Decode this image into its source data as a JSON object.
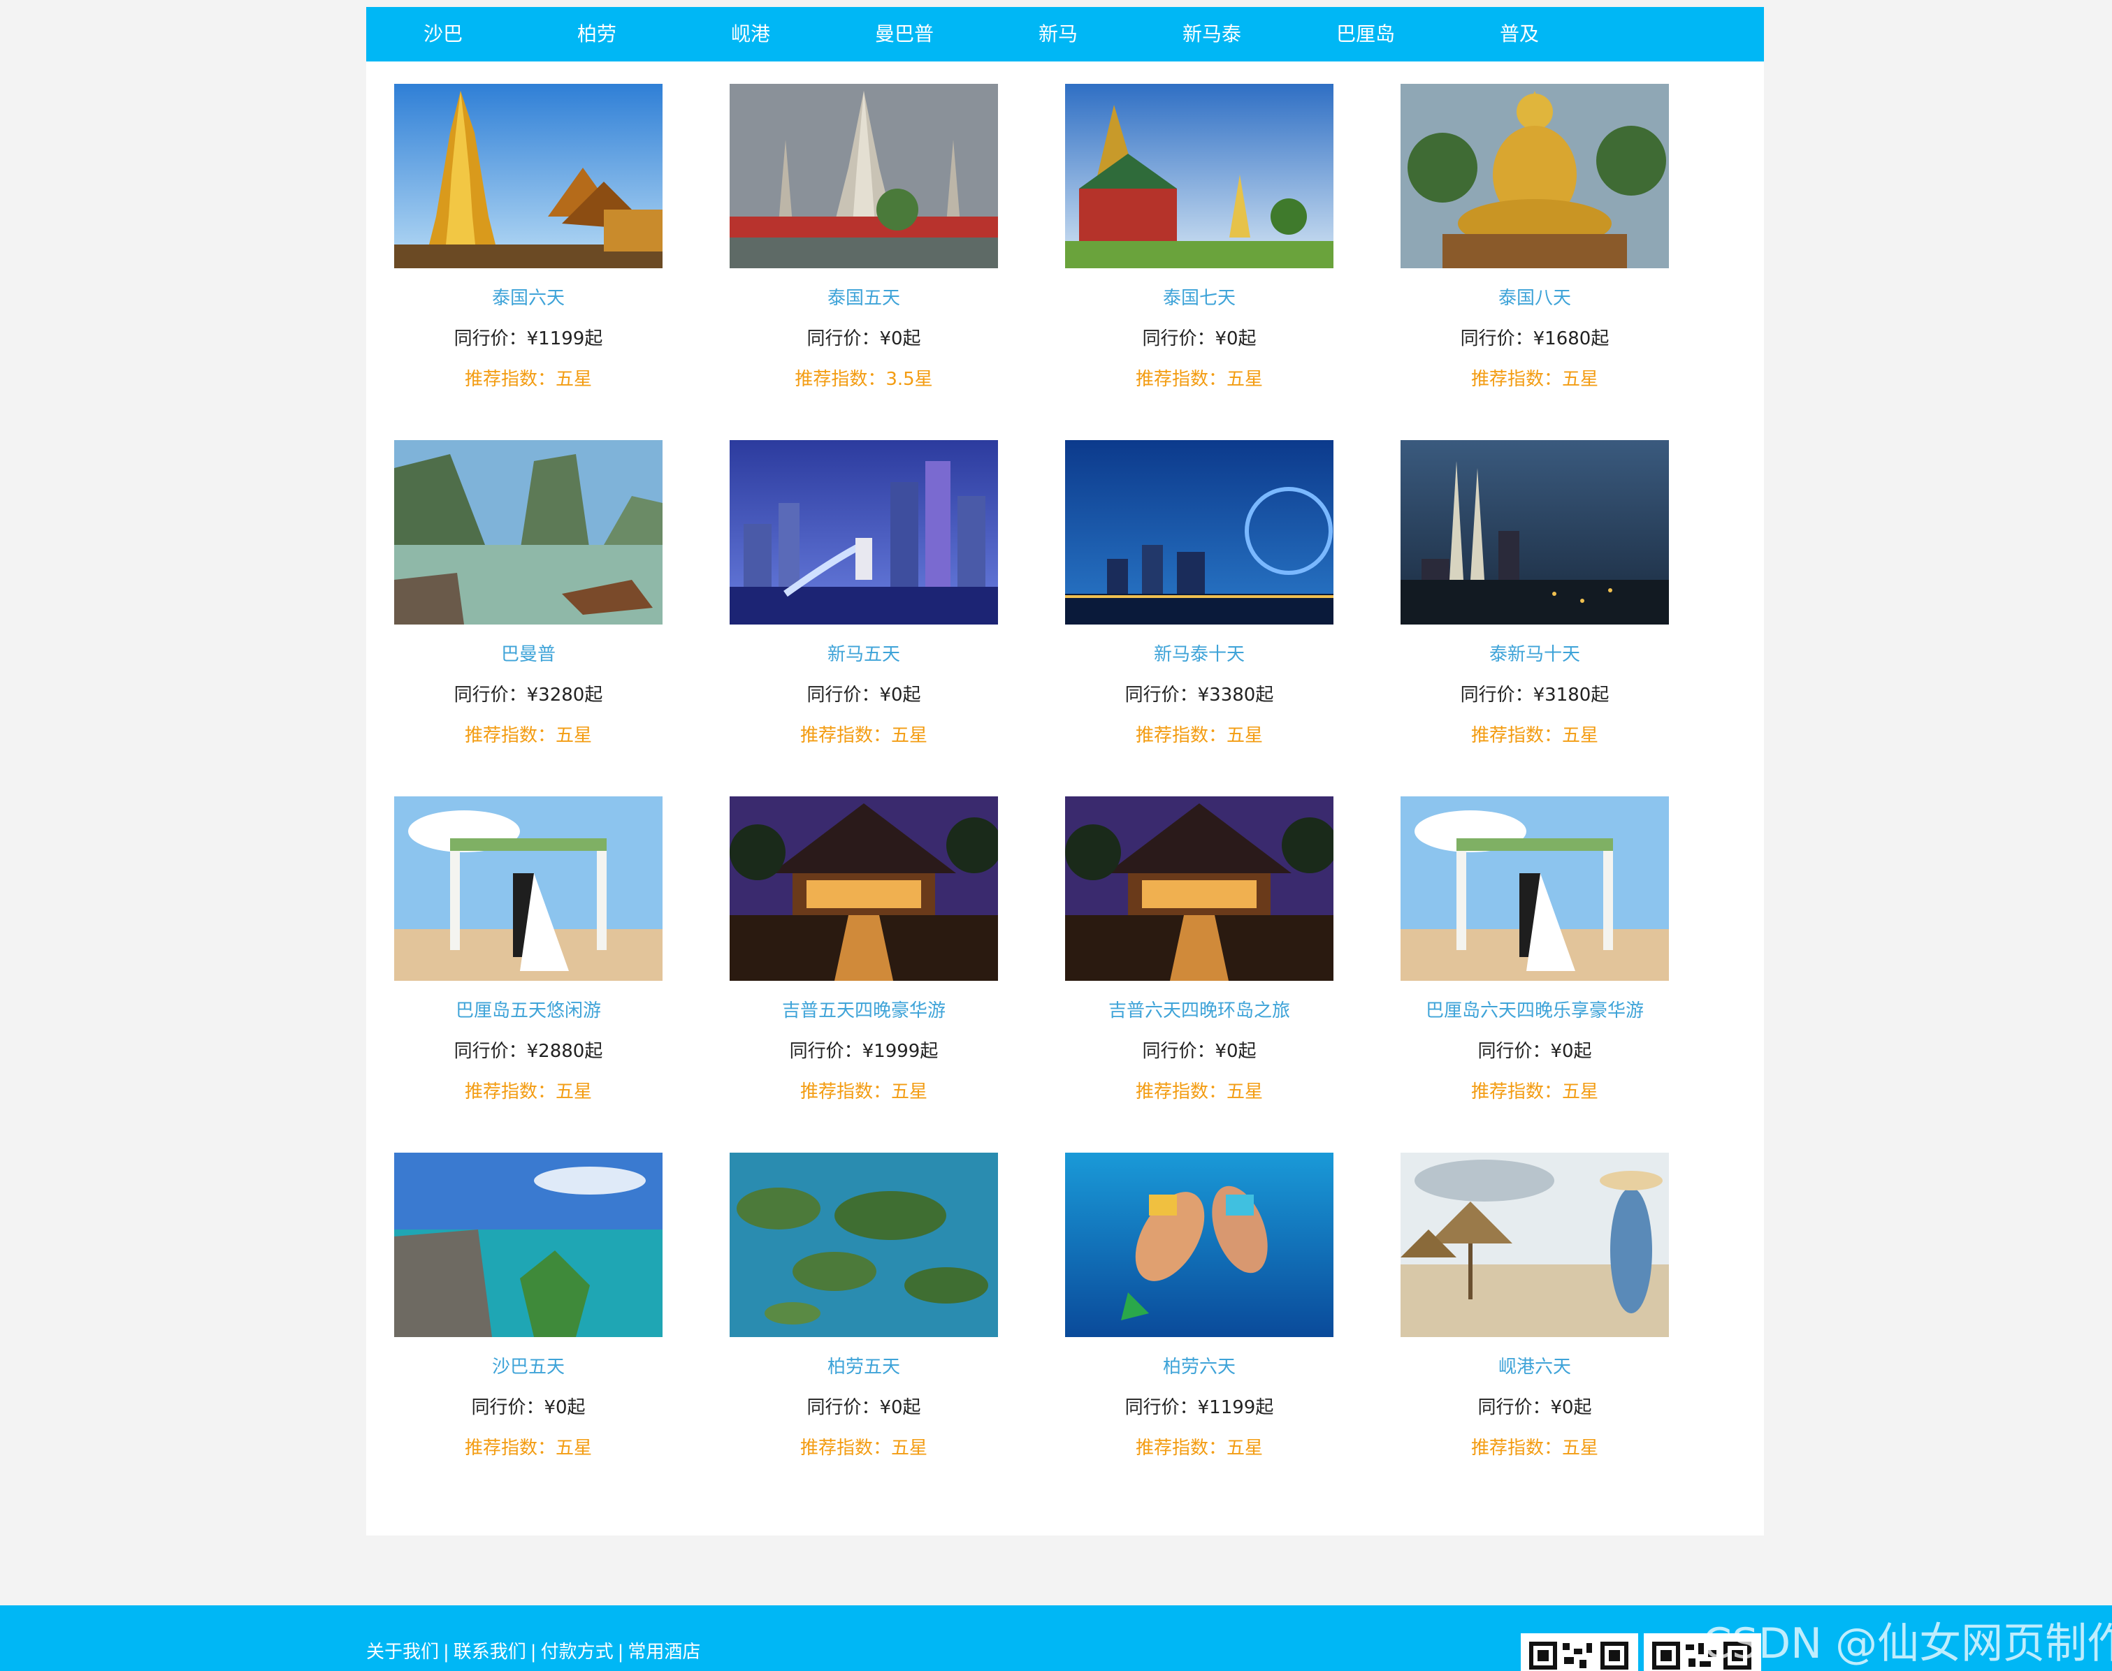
{
  "nav": {
    "items": [
      "沙巴",
      "柏劳",
      "岘港",
      "曼巴普",
      "新马",
      "新马泰",
      "巴厘岛",
      "普及"
    ]
  },
  "products": [
    {
      "title": "泰国六天",
      "price": "同行价：¥1199起",
      "rating": "推荐指数：五星",
      "image": "golden-pagoda"
    },
    {
      "title": "泰国五天",
      "price": "同行价：¥0起",
      "rating": "推荐指数：3.5星",
      "image": "wat-arun"
    },
    {
      "title": "泰国七天",
      "price": "同行价：¥0起",
      "rating": "推荐指数：五星",
      "image": "grand-palace"
    },
    {
      "title": "泰国八天",
      "price": "同行价：¥1680起",
      "rating": "推荐指数：五星",
      "image": "golden-buddha"
    },
    {
      "title": "巴曼普",
      "price": "同行价：¥3280起",
      "rating": "推荐指数：五星",
      "image": "phang-nga-bay"
    },
    {
      "title": "新马五天",
      "price": "同行价：¥0起",
      "rating": "推荐指数：五星",
      "image": "merlion-night"
    },
    {
      "title": "新马泰十天",
      "price": "同行价：¥3380起",
      "rating": "推荐指数：五星",
      "image": "singapore-flyer"
    },
    {
      "title": "泰新马十天",
      "price": "同行价：¥3180起",
      "rating": "推荐指数：五星",
      "image": "petronas-towers"
    },
    {
      "title": "巴厘岛五天悠闲游",
      "price": "同行价：¥2880起",
      "rating": "推荐指数：五星",
      "image": "beach-wedding"
    },
    {
      "title": "吉普五天四晚豪华游",
      "price": "同行价：¥1999起",
      "rating": "推荐指数：五星",
      "image": "resort-night"
    },
    {
      "title": "吉普六天四晚环岛之旅",
      "price": "同行价：¥0起",
      "rating": "推荐指数：五星",
      "image": "resort-night"
    },
    {
      "title": "巴厘岛六天四晚乐享豪华游",
      "price": "同行价：¥0起",
      "rating": "推荐指数：五星",
      "image": "beach-wedding"
    },
    {
      "title": "沙巴五天",
      "price": "同行价：¥0起",
      "rating": "推荐指数：五星",
      "image": "boardwalk-sea"
    },
    {
      "title": "柏劳五天",
      "price": "同行价：¥0起",
      "rating": "推荐指数：五星",
      "image": "rock-islands"
    },
    {
      "title": "柏劳六天",
      "price": "同行价：¥1199起",
      "rating": "推荐指数：五星",
      "image": "snorkeling"
    },
    {
      "title": "岘港六天",
      "price": "同行价：¥0起",
      "rating": "推荐指数：五星",
      "image": "beach-umbrellas"
    }
  ],
  "footer": {
    "links": [
      "关于我们",
      "联系我们",
      "付款方式",
      "常用酒店"
    ],
    "separator": "|"
  },
  "watermark": "CSDN @仙女网页制作",
  "colors": {
    "accent": "#00b7f5",
    "title": "#3ea3d8",
    "rating": "#f39c12",
    "background": "#f3f3f3"
  }
}
